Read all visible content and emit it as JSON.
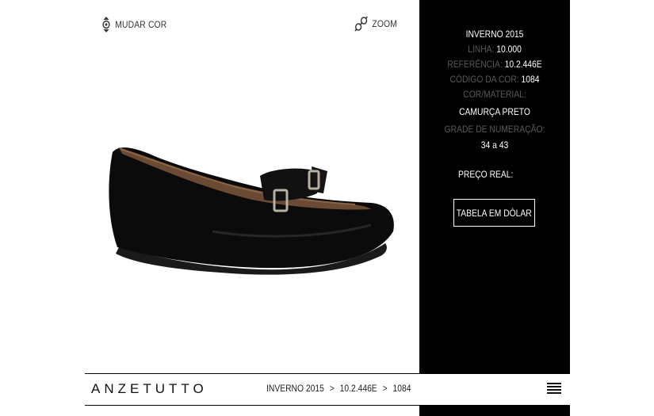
{
  "toolbar": {
    "change_color_label": "MUDAR COR",
    "zoom_label": "ZOOM"
  },
  "product": {
    "image_alt": "Sapatilha camurça preta com laço"
  },
  "specs": {
    "season": "INVERNO 2015",
    "line_label": "LINHA:",
    "line_value": "10.000",
    "ref_label": "REFERÊNCIA:",
    "ref_value": "10.2.446E",
    "color_code_label": "CÓDIGO DA COR:",
    "color_code_value": "1084",
    "material_label": "COR/MATERIAL:",
    "material_value": "CAMURÇA PRETO",
    "sizes_label": "GRADE DE NUMERAÇÃO:",
    "sizes_value": "34 a 43",
    "price_label": "PREÇO REAL:",
    "dollar_button": "TABELA EM DÓLAR"
  },
  "footer": {
    "brand": "ANZETUTTO",
    "breadcrumb": [
      "INVERNO 2015",
      "10.2.446E",
      "1084"
    ],
    "separator": ">"
  },
  "colors": {
    "panel_bg": "#000000",
    "label_gray": "#5a5a5a",
    "text": "#222222"
  },
  "icons": [
    "color-swap-icon",
    "zoom-icon",
    "hamburger-menu-icon",
    "chevron-right-icon"
  ]
}
